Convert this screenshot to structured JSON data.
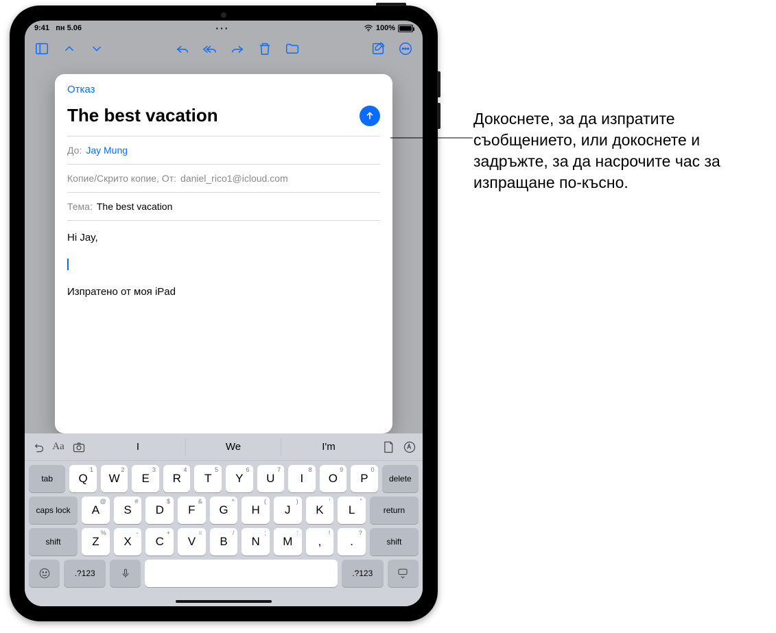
{
  "status": {
    "time": "9:41",
    "date": "пн 5.06",
    "battery_pct": "100%"
  },
  "compose": {
    "cancel": "Отказ",
    "title": "The best vacation",
    "to_label": "До:",
    "to_value": "Jay Mung",
    "cc_label": "Копие/Скрито копие, От:",
    "cc_value": "daniel_rico1@icloud.com",
    "subject_label": "Тема:",
    "subject_value": "The best vacation",
    "body_greeting": "Hi Jay,",
    "body_signature": "Изпратено от моя iPad"
  },
  "keyboard": {
    "suggestions": [
      "I",
      "We",
      "I'm"
    ],
    "row1": [
      {
        "k": "Q",
        "s": "1"
      },
      {
        "k": "W",
        "s": "2"
      },
      {
        "k": "E",
        "s": "3"
      },
      {
        "k": "R",
        "s": "4"
      },
      {
        "k": "T",
        "s": "5"
      },
      {
        "k": "Y",
        "s": "6"
      },
      {
        "k": "U",
        "s": "7"
      },
      {
        "k": "I",
        "s": "8"
      },
      {
        "k": "O",
        "s": "9"
      },
      {
        "k": "P",
        "s": "0"
      }
    ],
    "row2": [
      {
        "k": "A",
        "s": "@"
      },
      {
        "k": "S",
        "s": "#"
      },
      {
        "k": "D",
        "s": "$"
      },
      {
        "k": "F",
        "s": "&"
      },
      {
        "k": "G",
        "s": "*"
      },
      {
        "k": "H",
        "s": "("
      },
      {
        "k": "J",
        "s": ")"
      },
      {
        "k": "K",
        "s": "'"
      },
      {
        "k": "L",
        "s": "\""
      }
    ],
    "row3": [
      {
        "k": "Z",
        "s": "%"
      },
      {
        "k": "X",
        "s": "-"
      },
      {
        "k": "C",
        "s": "+"
      },
      {
        "k": "V",
        "s": "="
      },
      {
        "k": "B",
        "s": "/"
      },
      {
        "k": "N",
        "s": ";"
      },
      {
        "k": "M",
        "s": ":"
      }
    ],
    "tab": "tab",
    "delete": "delete",
    "caps": "caps lock",
    "return": "return",
    "shift": "shift",
    "numsym": ".?123",
    "comma_sub": "!",
    "period_sub": "?"
  },
  "annotation": "Докоснете, за да изпратите съобщението, или докоснете и задръжте, за да насрочите час за изпращане по-късно."
}
